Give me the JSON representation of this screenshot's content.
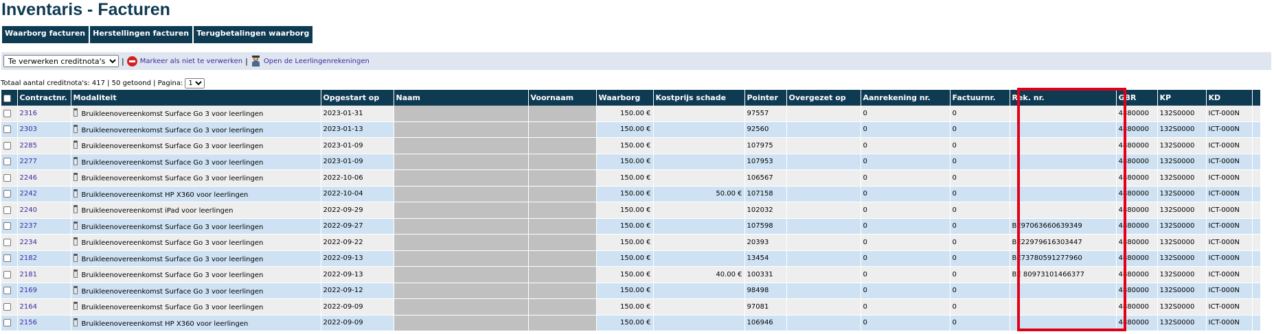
{
  "page": {
    "title": "Inventaris - Facturen"
  },
  "tabs": [
    "Waarborg facturen",
    "Herstellingen facturen",
    "Terugbetalingen waarborg"
  ],
  "actionbar": {
    "select_value": "Te verwerken creditnota's",
    "mark_link": "Markeer als niet te verwerken",
    "open_link": "Open de Leerlingenrekeningen",
    "icons": [
      "stop-icon",
      "student-icon"
    ]
  },
  "totals": {
    "text": "Totaal aantal creditnota's: 417 | 50 getoond | Pagina:",
    "page": "1"
  },
  "table": {
    "headers": [
      "",
      "Contractnr.",
      "Modaliteit",
      "Opgestart op",
      "Naam",
      "Voornaam",
      "Waarborg",
      "Kostprijs schade",
      "Pointer",
      "Overgezet op",
      "Aanrekening nr.",
      "Factuurnr.",
      "Rek. nr.",
      "GBR",
      "KP",
      "KD",
      ""
    ],
    "rows": [
      {
        "contract": "2316",
        "modaliteit": "Bruikleenovereenkomst Surface Go 3 voor leerlingen",
        "opgestart": "2023-01-31",
        "waarborg": "150.00 €",
        "kostprijs": "",
        "pointer": "97557",
        "aanrekening": "0",
        "factuur": "0",
        "rek": "",
        "gbr": "4880000",
        "kp": "132S0000",
        "kd": "ICT-000N"
      },
      {
        "contract": "2303",
        "modaliteit": "Bruikleenovereenkomst Surface Go 3 voor leerlingen",
        "opgestart": "2023-01-13",
        "waarborg": "150.00 €",
        "kostprijs": "",
        "pointer": "92560",
        "aanrekening": "0",
        "factuur": "0",
        "rek": "",
        "gbr": "4880000",
        "kp": "132S0000",
        "kd": "ICT-000N"
      },
      {
        "contract": "2285",
        "modaliteit": "Bruikleenovereenkomst Surface Go 3 voor leerlingen",
        "opgestart": "2023-01-09",
        "waarborg": "150.00 €",
        "kostprijs": "",
        "pointer": "107975",
        "aanrekening": "0",
        "factuur": "0",
        "rek": "",
        "gbr": "4880000",
        "kp": "132S0000",
        "kd": "ICT-000N"
      },
      {
        "contract": "2277",
        "modaliteit": "Bruikleenovereenkomst Surface Go 3 voor leerlingen",
        "opgestart": "2023-01-09",
        "waarborg": "150.00 €",
        "kostprijs": "",
        "pointer": "107953",
        "aanrekening": "0",
        "factuur": "0",
        "rek": "",
        "gbr": "4880000",
        "kp": "132S0000",
        "kd": "ICT-000N"
      },
      {
        "contract": "2246",
        "modaliteit": "Bruikleenovereenkomst Surface Go 3 voor leerlingen",
        "opgestart": "2022-10-06",
        "waarborg": "150.00 €",
        "kostprijs": "",
        "pointer": "106567",
        "aanrekening": "0",
        "factuur": "0",
        "rek": "",
        "gbr": "4880000",
        "kp": "132S0000",
        "kd": "ICT-000N"
      },
      {
        "contract": "2242",
        "modaliteit": "Bruikleenovereenkomst HP X360 voor leerlingen",
        "opgestart": "2022-10-04",
        "waarborg": "150.00 €",
        "kostprijs": "50.00 €",
        "pointer": "107158",
        "aanrekening": "0",
        "factuur": "0",
        "rek": "",
        "gbr": "4880000",
        "kp": "132S0000",
        "kd": "ICT-000N"
      },
      {
        "contract": "2240",
        "modaliteit": "Bruikleenovereenkomst iPad voor leerlingen",
        "opgestart": "2022-09-29",
        "waarborg": "150.00 €",
        "kostprijs": "",
        "pointer": "102032",
        "aanrekening": "0",
        "factuur": "0",
        "rek": "",
        "gbr": "4880000",
        "kp": "132S0000",
        "kd": "ICT-000N"
      },
      {
        "contract": "2237",
        "modaliteit": "Bruikleenovereenkomst Surface Go 3 voor leerlingen",
        "opgestart": "2022-09-27",
        "waarborg": "150.00 €",
        "kostprijs": "",
        "pointer": "107598",
        "aanrekening": "0",
        "factuur": "0",
        "rek": "BE97063660639349",
        "gbr": "4880000",
        "kp": "132S0000",
        "kd": "ICT-000N"
      },
      {
        "contract": "2234",
        "modaliteit": "Bruikleenovereenkomst Surface Go 3 voor leerlingen",
        "opgestart": "2022-09-22",
        "waarborg": "150.00 €",
        "kostprijs": "",
        "pointer": "20393",
        "aanrekening": "0",
        "factuur": "0",
        "rek": "BE22979616303447",
        "gbr": "4880000",
        "kp": "132S0000",
        "kd": "ICT-000N"
      },
      {
        "contract": "2182",
        "modaliteit": "Bruikleenovereenkomst Surface Go 3 voor leerlingen",
        "opgestart": "2022-09-13",
        "waarborg": "150.00 €",
        "kostprijs": "",
        "pointer": "13454",
        "aanrekening": "0",
        "factuur": "0",
        "rek": "BE73780591277960",
        "gbr": "4880000",
        "kp": "132S0000",
        "kd": "ICT-000N"
      },
      {
        "contract": "2181",
        "modaliteit": "Bruikleenovereenkomst Surface Go 3 voor leerlingen",
        "opgestart": "2022-09-13",
        "waarborg": "150.00 €",
        "kostprijs": "40.00 €",
        "pointer": "100331",
        "aanrekening": "0",
        "factuur": "0",
        "rek": "BE 80973101466377",
        "gbr": "4880000",
        "kp": "132S0000",
        "kd": "ICT-000N"
      },
      {
        "contract": "2169",
        "modaliteit": "Bruikleenovereenkomst Surface Go 3 voor leerlingen",
        "opgestart": "2022-09-12",
        "waarborg": "150.00 €",
        "kostprijs": "",
        "pointer": "98498",
        "aanrekening": "0",
        "factuur": "0",
        "rek": "",
        "gbr": "4880000",
        "kp": "132S0000",
        "kd": "ICT-000N"
      },
      {
        "contract": "2164",
        "modaliteit": "Bruikleenovereenkomst Surface Go 3 voor leerlingen",
        "opgestart": "2022-09-09",
        "waarborg": "150.00 €",
        "kostprijs": "",
        "pointer": "97081",
        "aanrekening": "0",
        "factuur": "0",
        "rek": "",
        "gbr": "4880000",
        "kp": "132S0000",
        "kd": "ICT-000N"
      },
      {
        "contract": "2156",
        "modaliteit": "Bruikleenovereenkomst HP X360 voor leerlingen",
        "opgestart": "2022-09-09",
        "waarborg": "150.00 €",
        "kostprijs": "",
        "pointer": "106946",
        "aanrekening": "0",
        "factuur": "0",
        "rek": "",
        "gbr": "4880000",
        "kp": "132S0000",
        "kd": "ICT-000N"
      }
    ]
  },
  "colors": {
    "header_bg": "#0e3a52",
    "row_odd": "#eeeeee",
    "row_even": "#cfe2f3",
    "redacted": "#c0c0c0",
    "highlight": "#e0001a",
    "link": "#3a2aa0"
  }
}
